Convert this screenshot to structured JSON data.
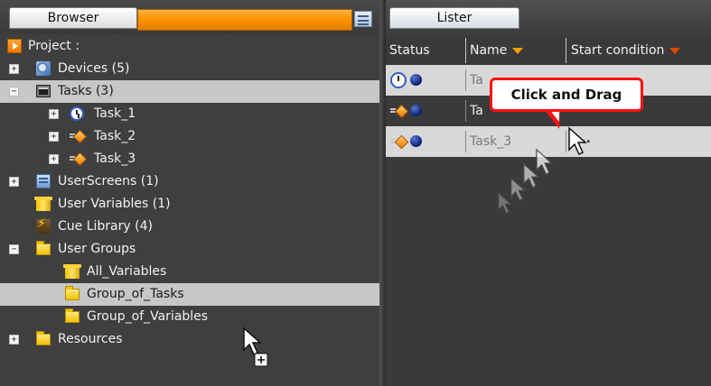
{
  "browser": {
    "tab_label": "Browser",
    "view_toggle_icon": "list-view-icon",
    "tree": [
      {
        "label": "Project :",
        "icon": "project-icon",
        "expander": ""
      },
      {
        "label": "Devices (5)",
        "icon": "devices-icon",
        "expander": "+"
      },
      {
        "label": "Tasks (3)",
        "icon": "tasks-icon",
        "expander": "−",
        "selected": true
      },
      {
        "label": "Task_1",
        "icon": "clock-icon",
        "expander": "+"
      },
      {
        "label": "Task_2",
        "icon": "task-icon",
        "expander": "+"
      },
      {
        "label": "Task_3",
        "icon": "task-icon",
        "expander": "+"
      },
      {
        "label": "UserScreens (1)",
        "icon": "screens-icon",
        "expander": "+"
      },
      {
        "label": "User Variables (1)",
        "icon": "user-variables-icon",
        "expander": ""
      },
      {
        "label": "Cue Library (4)",
        "icon": "cue-library-icon",
        "expander": ""
      },
      {
        "label": "User Groups",
        "icon": "folder-icon",
        "expander": "−"
      },
      {
        "label": "All_Variables",
        "icon": "user-variables-icon",
        "expander": ""
      },
      {
        "label": "Group_of_Tasks",
        "icon": "folder-icon",
        "expander": "",
        "selected": true
      },
      {
        "label": "Group_of_Variables",
        "icon": "folder-icon",
        "expander": ""
      },
      {
        "label": "Resources",
        "icon": "folder-icon",
        "expander": "+"
      }
    ]
  },
  "lister": {
    "tab_label": "Lister",
    "columns": {
      "status": "Status",
      "name": "Name",
      "start_condition": "Start condition"
    },
    "rows": [
      {
        "status_icon": "clock-icon",
        "name": "Ta",
        "start_condition": ""
      },
      {
        "status_icon": "task-icon",
        "name": "Ta",
        "start_condition": ""
      },
      {
        "status_icon": "task-icon",
        "name": "Task_3",
        "start_condition": "..."
      }
    ]
  },
  "callout": {
    "text": "Click and Drag"
  },
  "colors": {
    "accent_orange": "#ff9400",
    "callout_border": "#ff1111",
    "selection_gray": "#c7c7c7"
  }
}
